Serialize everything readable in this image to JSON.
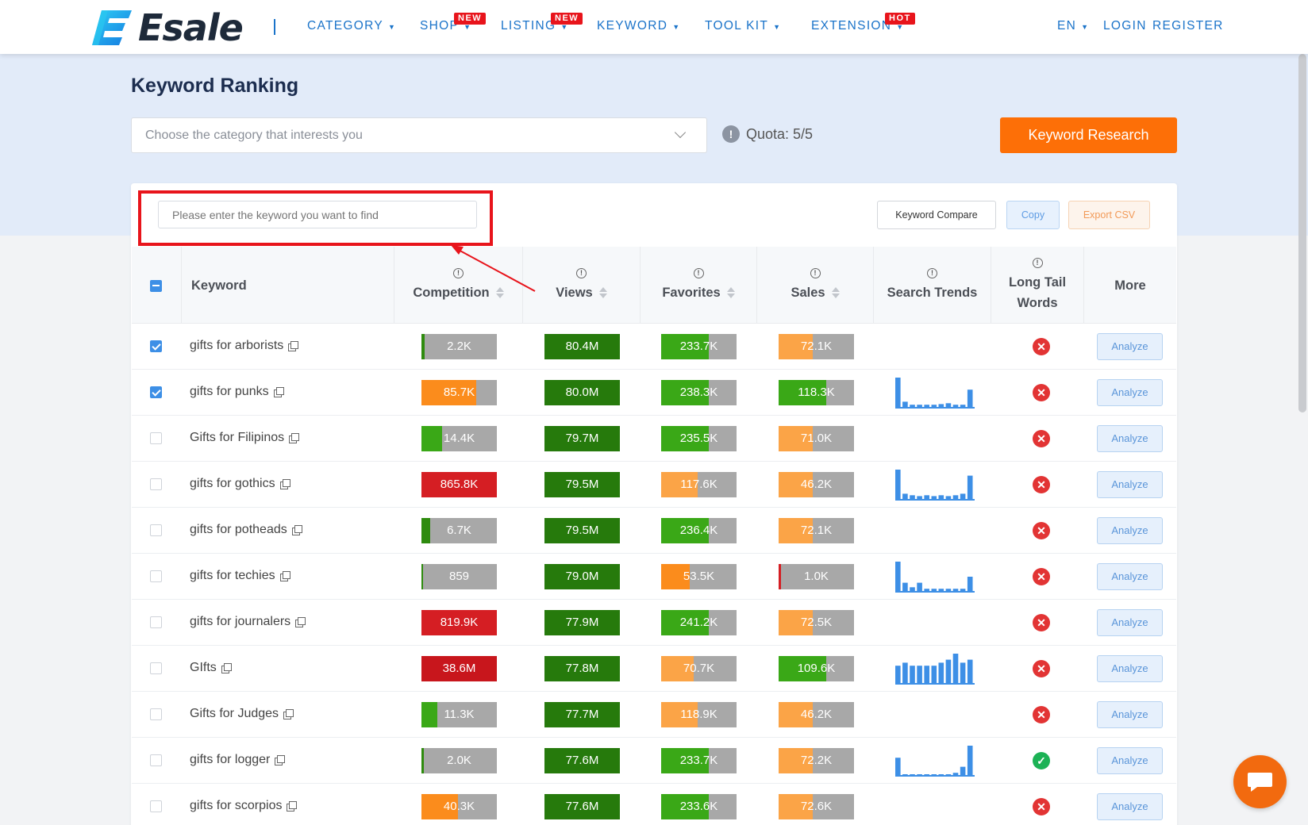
{
  "brand": {
    "name": "Esale"
  },
  "nav": {
    "items": [
      {
        "label": "CATEGORY",
        "badge": ""
      },
      {
        "label": "SHOP",
        "badge": "NEW"
      },
      {
        "label": "LISTING",
        "badge": "NEW"
      },
      {
        "label": "KEYWORD",
        "badge": ""
      },
      {
        "label": "TOOL KIT",
        "badge": ""
      },
      {
        "label": "EXTENSION",
        "badge": "HOT"
      }
    ],
    "language": "EN",
    "login": "LOGIN",
    "register": "REGISTER"
  },
  "page": {
    "title": "Keyword Ranking",
    "category_placeholder": "Choose the category that interests you",
    "quota": "Quota: 5/5",
    "research_button": "Keyword Research"
  },
  "toolbar": {
    "search_placeholder": "Please enter the keyword you want to find",
    "compare": "Keyword Compare",
    "copy": "Copy",
    "export": "Export CSV"
  },
  "table": {
    "headers": {
      "keyword": "Keyword",
      "competition": "Competition",
      "views": "Views",
      "favorites": "Favorites",
      "sales": "Sales",
      "search_trends": "Search Trends",
      "long_tail": "Long Tail Words",
      "more": "More"
    },
    "analyze_label": "Analyze",
    "rows": [
      {
        "keyword": "gifts for arborists",
        "checked": true,
        "competition": {
          "value": "2.2K",
          "fill": 0.04,
          "color": "#2e8b0e"
        },
        "views": {
          "value": "80.4M",
          "fill": 1.0,
          "color": "#267a0c"
        },
        "favorites": {
          "value": "233.7K",
          "fill": 0.63,
          "color": "#3aa817"
        },
        "sales": {
          "value": "72.1K",
          "fill": 0.45,
          "color": "#fba447"
        },
        "trend": [],
        "long_tail": false
      },
      {
        "keyword": "gifts for punks",
        "checked": true,
        "competition": {
          "value": "85.7K",
          "fill": 0.73,
          "color": "#fb8c1c"
        },
        "views": {
          "value": "80.0M",
          "fill": 1.0,
          "color": "#267a0c"
        },
        "favorites": {
          "value": "238.3K",
          "fill": 0.63,
          "color": "#3aa817"
        },
        "sales": {
          "value": "118.3K",
          "fill": 0.63,
          "color": "#3aa817"
        },
        "trend": [
          10,
          2,
          1,
          1,
          1,
          1,
          1.2,
          1.5,
          1,
          1,
          6
        ],
        "long_tail": false
      },
      {
        "keyword": "Gifts for Filipinos",
        "checked": false,
        "competition": {
          "value": "14.4K",
          "fill": 0.27,
          "color": "#3aa817"
        },
        "views": {
          "value": "79.7M",
          "fill": 1.0,
          "color": "#267a0c"
        },
        "favorites": {
          "value": "235.5K",
          "fill": 0.63,
          "color": "#3aa817"
        },
        "sales": {
          "value": "71.0K",
          "fill": 0.45,
          "color": "#fba447"
        },
        "trend": [],
        "long_tail": false
      },
      {
        "keyword": "gifts for gothics",
        "checked": false,
        "competition": {
          "value": "865.8K",
          "fill": 1.0,
          "color": "#d51e23"
        },
        "views": {
          "value": "79.5M",
          "fill": 1.0,
          "color": "#267a0c"
        },
        "favorites": {
          "value": "117.6K",
          "fill": 0.48,
          "color": "#fba447"
        },
        "sales": {
          "value": "46.2K",
          "fill": 0.45,
          "color": "#fba447"
        },
        "trend": [
          10,
          2,
          1.5,
          1.2,
          1.5,
          1.2,
          1.5,
          1.2,
          1.5,
          2,
          8
        ],
        "long_tail": false
      },
      {
        "keyword": "gifts for potheads",
        "checked": false,
        "competition": {
          "value": "6.7K",
          "fill": 0.12,
          "color": "#2e8b0e"
        },
        "views": {
          "value": "79.5M",
          "fill": 1.0,
          "color": "#267a0c"
        },
        "favorites": {
          "value": "236.4K",
          "fill": 0.63,
          "color": "#3aa817"
        },
        "sales": {
          "value": "72.1K",
          "fill": 0.45,
          "color": "#fba447"
        },
        "trend": [],
        "long_tail": false
      },
      {
        "keyword": "gifts for techies",
        "checked": false,
        "competition": {
          "value": "859",
          "fill": 0.02,
          "color": "#2e8b0e"
        },
        "views": {
          "value": "79.0M",
          "fill": 1.0,
          "color": "#267a0c"
        },
        "favorites": {
          "value": "53.5K",
          "fill": 0.38,
          "color": "#fb8c1c"
        },
        "sales": {
          "value": "1.0K",
          "fill": 0.03,
          "color": "#d51e23"
        },
        "trend": [
          10,
          3,
          1.5,
          3,
          1,
          1,
          1,
          1,
          1,
          1,
          5
        ],
        "long_tail": false
      },
      {
        "keyword": "gifts for journalers",
        "checked": false,
        "competition": {
          "value": "819.9K",
          "fill": 1.0,
          "color": "#d51e23"
        },
        "views": {
          "value": "77.9M",
          "fill": 1.0,
          "color": "#267a0c"
        },
        "favorites": {
          "value": "241.2K",
          "fill": 0.63,
          "color": "#3aa817"
        },
        "sales": {
          "value": "72.5K",
          "fill": 0.45,
          "color": "#fba447"
        },
        "trend": [],
        "long_tail": false
      },
      {
        "keyword": "GIfts",
        "checked": false,
        "competition": {
          "value": "38.6M",
          "fill": 1.0,
          "color": "#c8161c"
        },
        "views": {
          "value": "77.8M",
          "fill": 1.0,
          "color": "#267a0c"
        },
        "favorites": {
          "value": "70.7K",
          "fill": 0.43,
          "color": "#fba447"
        },
        "sales": {
          "value": "109.6K",
          "fill": 0.63,
          "color": "#3aa817"
        },
        "trend": [
          6,
          7,
          6,
          6,
          6,
          6,
          7,
          8,
          10,
          7,
          8
        ],
        "long_tail": false
      },
      {
        "keyword": "Gifts for Judges",
        "checked": false,
        "competition": {
          "value": "11.3K",
          "fill": 0.21,
          "color": "#3aa817"
        },
        "views": {
          "value": "77.7M",
          "fill": 1.0,
          "color": "#267a0c"
        },
        "favorites": {
          "value": "118.9K",
          "fill": 0.48,
          "color": "#fba447"
        },
        "sales": {
          "value": "46.2K",
          "fill": 0.45,
          "color": "#fba447"
        },
        "trend": [],
        "long_tail": false
      },
      {
        "keyword": "gifts for logger",
        "checked": false,
        "competition": {
          "value": "2.0K",
          "fill": 0.03,
          "color": "#2e8b0e"
        },
        "views": {
          "value": "77.6M",
          "fill": 1.0,
          "color": "#267a0c"
        },
        "favorites": {
          "value": "233.7K",
          "fill": 0.63,
          "color": "#3aa817"
        },
        "sales": {
          "value": "72.2K",
          "fill": 0.45,
          "color": "#fba447"
        },
        "trend": [
          6,
          0.5,
          0.5,
          0.5,
          0.5,
          0.5,
          0.5,
          0.5,
          1,
          3,
          10
        ],
        "long_tail": true
      },
      {
        "keyword": "gifts for scorpios",
        "checked": false,
        "competition": {
          "value": "40.3K",
          "fill": 0.48,
          "color": "#fb8c1c"
        },
        "views": {
          "value": "77.6M",
          "fill": 1.0,
          "color": "#267a0c"
        },
        "favorites": {
          "value": "233.6K",
          "fill": 0.63,
          "color": "#3aa817"
        },
        "sales": {
          "value": "72.6K",
          "fill": 0.45,
          "color": "#fba447"
        },
        "trend": [],
        "long_tail": false
      }
    ]
  },
  "colors": {
    "accent": "#fd6f07",
    "nav": "#1a73c9",
    "trend_bar": "#3d8fe6",
    "highlight": "#e8141b"
  }
}
